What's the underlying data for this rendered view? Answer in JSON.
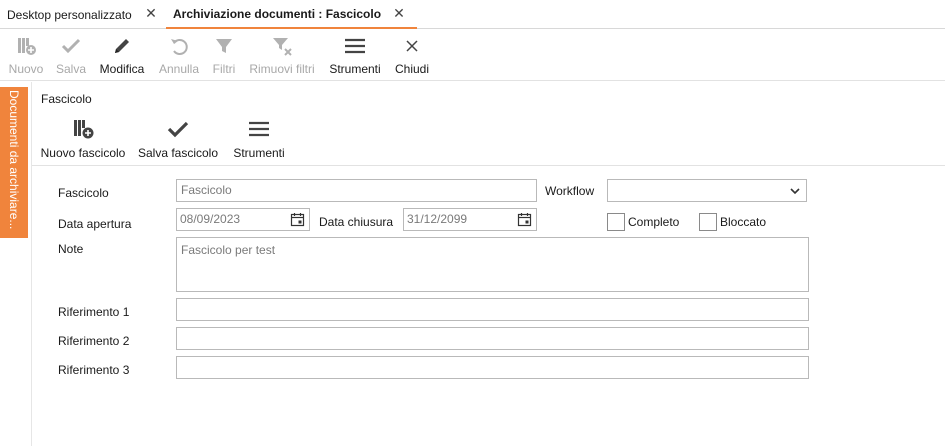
{
  "tabs": [
    {
      "label": "Desktop personalizzato",
      "active": false
    },
    {
      "label": "Archiviazione documenti : Fascicolo",
      "active": true
    }
  ],
  "toolbar": {
    "nuovo": "Nuovo",
    "salva": "Salva",
    "modifica": "Modifica",
    "annulla": "Annulla",
    "filtri": "Filtri",
    "rimuovi_filtri": "Rimuovi filtri",
    "strumenti": "Strumenti",
    "chiudi": "Chiudi"
  },
  "side_panel": {
    "label": "Documenti da archiviare..."
  },
  "section": {
    "title": "Fascicolo"
  },
  "subtoolbar": {
    "nuovo_fascicolo": "Nuovo fascicolo",
    "salva_fascicolo": "Salva fascicolo",
    "strumenti": "Strumenti"
  },
  "form": {
    "fascicolo_label": "Fascicolo",
    "fascicolo_value": "Fascicolo",
    "workflow_label": "Workflow",
    "workflow_value": "",
    "data_apertura_label": "Data apertura",
    "data_apertura_value": "08/09/2023",
    "data_chiusura_label": "Data chiusura",
    "data_chiusura_value": "31/12/2099",
    "completo_label": "Completo",
    "bloccato_label": "Bloccato",
    "note_label": "Note",
    "note_value": "Fascicolo per test",
    "riferimento1_label": "Riferimento 1",
    "riferimento1_value": "",
    "riferimento2_label": "Riferimento 2",
    "riferimento2_value": "",
    "riferimento3_label": "Riferimento 3",
    "riferimento3_value": ""
  },
  "colors": {
    "accent": "#f0843c"
  }
}
